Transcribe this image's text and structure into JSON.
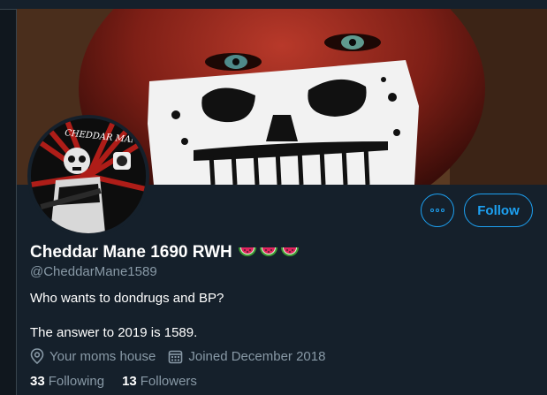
{
  "profile": {
    "display_name": "Cheddar Mane 1690 RWH",
    "name_emoji": [
      "watermelon-icon",
      "watermelon-icon",
      "watermelon-icon"
    ],
    "handle": "@CheddarMane1589",
    "bio_line1": "Who wants to dondrugs and BP?",
    "bio_line2": "The answer to 2019 is 1589.",
    "location": "Your moms house",
    "joined": "Joined December 2018"
  },
  "avatar": {
    "text": "CHEDDAR MANE"
  },
  "actions": {
    "more_icon": "more-icon",
    "follow_label": "Follow"
  },
  "stats": {
    "following_count": "33",
    "following_label": "Following",
    "followers_count": "13",
    "followers_label": "Followers"
  },
  "colors": {
    "background": "#15202b",
    "accent": "#1da1f2",
    "secondary_text": "#8899a6",
    "primary_text": "#ffffff"
  }
}
